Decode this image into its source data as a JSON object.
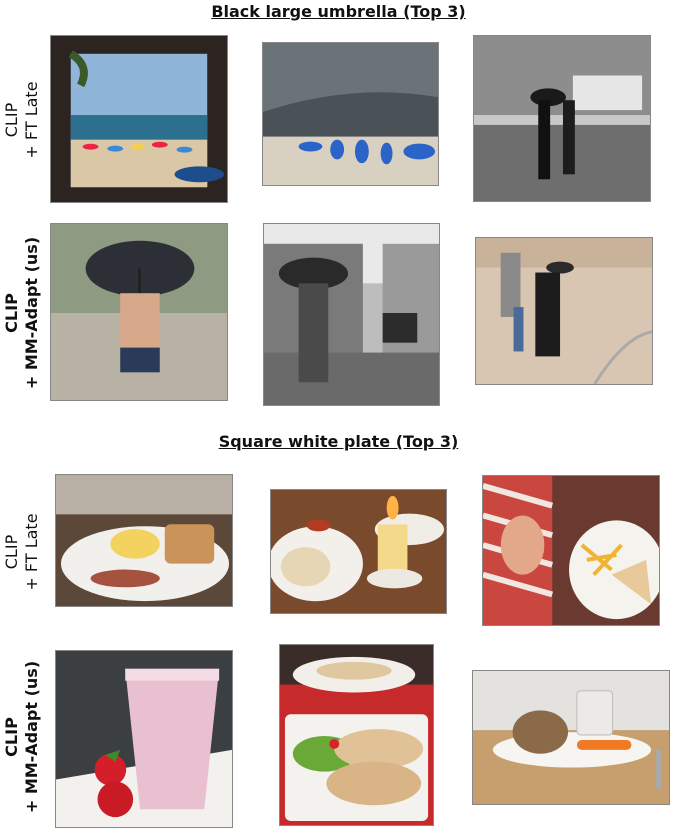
{
  "sections": [
    {
      "title": "Black large umbrella (Top 3)",
      "rows": [
        {
          "label_line1": "CLIP",
          "label_line2": "+ FT Late",
          "bold": false,
          "images": [
            "beach-window-photo",
            "stormy-beach-photo",
            "city-rain-bw-photo"
          ]
        },
        {
          "label_line1": "CLIP",
          "label_line2": "+ MM-Adapt (us)",
          "bold": true,
          "images": [
            "person-umbrella-rocks-photo",
            "rainy-street-bw-photo",
            "family-umbrella-photo"
          ]
        }
      ]
    },
    {
      "title": "Square white plate (Top 3)",
      "rows": [
        {
          "label_line1": "CLIP",
          "label_line2": "+ FT Late",
          "bold": false,
          "images": [
            "breakfast-plate-photo",
            "candle-dinner-photo",
            "sandwich-fries-photo"
          ]
        },
        {
          "label_line1": "CLIP",
          "label_line2": "+ MM-Adapt (us)",
          "bold": true,
          "images": [
            "smoothie-strawberry-photo",
            "sandwich-salad-photo",
            "rabbit-plate-photo"
          ]
        }
      ]
    }
  ]
}
